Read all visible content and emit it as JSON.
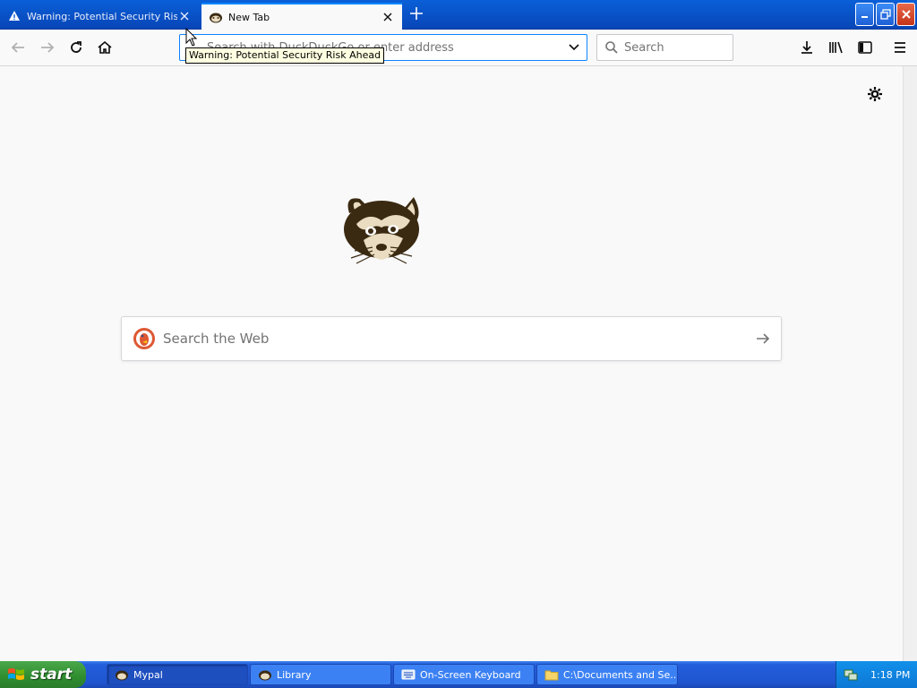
{
  "tabs": [
    {
      "title": "Warning: Potential Security Risk Ahead",
      "icon": "warning-icon",
      "active": false
    },
    {
      "title": "New Tab",
      "icon": "raccoon-icon",
      "active": true
    }
  ],
  "navbar": {
    "url_placeholder": "Search with DuckDuckGo or enter address",
    "search_placeholder": "Search"
  },
  "tooltip": "Warning: Potential Security Risk Ahead",
  "newtab": {
    "search_placeholder": "Search the Web"
  },
  "taskbar": {
    "start_label": "start",
    "tasks": [
      {
        "label": "Mypal",
        "icon": "raccoon-icon",
        "active": true
      },
      {
        "label": "Library",
        "icon": "raccoon-icon",
        "active": false
      },
      {
        "label": "On-Screen Keyboard",
        "icon": "keyboard-icon",
        "active": false
      },
      {
        "label": "C:\\Documents and Se...",
        "icon": "folder-icon",
        "active": false
      }
    ],
    "clock": "1:18 PM"
  },
  "colors": {
    "accent": "#0a84ff",
    "titlebar": "#0a5fd8",
    "taskbar": "#245edb",
    "start": "#2f8d2f"
  }
}
